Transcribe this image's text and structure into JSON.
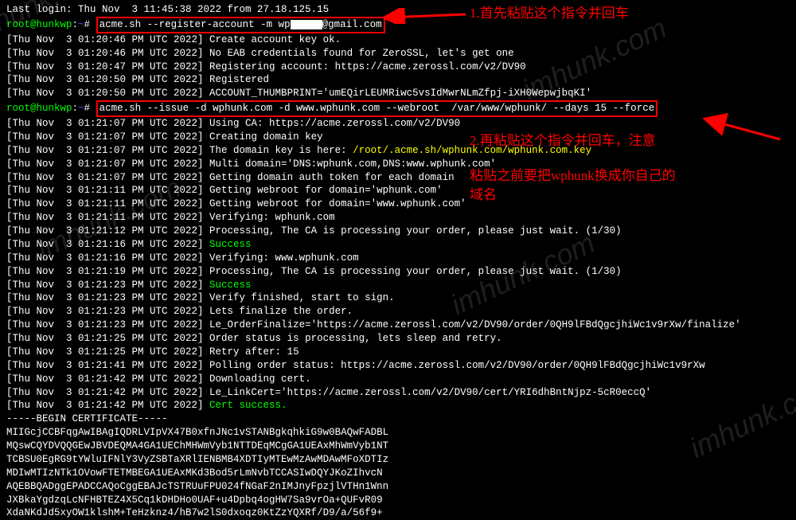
{
  "login_line": "Last login: Thu Nov  3 11:45:38 2022 from 27.18.125.15",
  "prompt": {
    "user_host": "root@hunkwp",
    "sep": ":",
    "path": "~",
    "symbol": "#"
  },
  "cmd1": {
    "before": "acme.sh --register-account -m wp",
    "after": "@gmail.com"
  },
  "cmd2": "acme.sh --issue -d wphunk.com -d www.wphunk.com --webroot  /var/www/wphunk/ --days 15 --force",
  "log_prefix": {
    "0": "[Thu Nov  3 01:20:46 PM UTC 2022] ",
    "1": "[Thu Nov  3 01:20:46 PM UTC 2022] ",
    "2": "[Thu Nov  3 01:20:47 PM UTC 2022] ",
    "3": "[Thu Nov  3 01:20:50 PM UTC 2022] ",
    "4": "[Thu Nov  3 01:20:50 PM UTC 2022] ",
    "5": "[Thu Nov  3 01:21:07 PM UTC 2022] ",
    "6": "[Thu Nov  3 01:21:07 PM UTC 2022] ",
    "7": "[Thu Nov  3 01:21:07 PM UTC 2022] ",
    "8": "[Thu Nov  3 01:21:07 PM UTC 2022] ",
    "9": "[Thu Nov  3 01:21:07 PM UTC 2022] ",
    "10": "[Thu Nov  3 01:21:11 PM UTC 2022] ",
    "11": "[Thu Nov  3 01:21:11 PM UTC 2022] ",
    "12": "[Thu Nov  3 01:21:11 PM UTC 2022] ",
    "13": "[Thu Nov  3 01:21:12 PM UTC 2022] ",
    "14": "[Thu Nov  3 01:21:16 PM UTC 2022] ",
    "15": "[Thu Nov  3 01:21:16 PM UTC 2022] ",
    "16": "[Thu Nov  3 01:21:19 PM UTC 2022] ",
    "17": "[Thu Nov  3 01:21:23 PM UTC 2022] ",
    "18": "[Thu Nov  3 01:21:23 PM UTC 2022] ",
    "19": "[Thu Nov  3 01:21:23 PM UTC 2022] ",
    "20": "[Thu Nov  3 01:21:23 PM UTC 2022] ",
    "21": "[Thu Nov  3 01:21:25 PM UTC 2022] ",
    "22": "[Thu Nov  3 01:21:25 PM UTC 2022] ",
    "23": "[Thu Nov  3 01:21:41 PM UTC 2022] ",
    "24": "[Thu Nov  3 01:21:42 PM UTC 2022] ",
    "25": "[Thu Nov  3 01:21:42 PM UTC 2022] ",
    "26": "[Thu Nov  3 01:21:42 PM UTC 2022] "
  },
  "log_msg": {
    "0": "Create account key ok.",
    "1": "No EAB credentials found for ZeroSSL, let's get one",
    "2": "Registering account: https://acme.zerossl.com/v2/DV90",
    "3": "Registered",
    "4": "ACCOUNT_THUMBPRINT='umEQirLEUMRiwc5vsIdMwrNLmZfpj-iXH0WepwjbqKI'",
    "5": "Using CA: https://acme.zerossl.com/v2/DV90",
    "6": "Creating domain key",
    "7a": "The domain key is here: ",
    "7b": "/root/.acme.sh/wphunk.com/wphunk.com.key",
    "8": "Multi domain='DNS:wphunk.com,DNS:www.wphunk.com'",
    "9": "Getting domain auth token for each domain",
    "10": "Getting webroot for domain='wphunk.com'",
    "11": "Getting webroot for domain='www.wphunk.com'",
    "12": "Verifying: wphunk.com",
    "13": "Processing, The CA is processing your order, please just wait. (1/30)",
    "14": "Success",
    "15": "Verifying: www.wphunk.com",
    "16": "Processing, The CA is processing your order, please just wait. (1/30)",
    "17": "Success",
    "18": "Verify finished, start to sign.",
    "19": "Lets finalize the order.",
    "20": "Le_OrderFinalize='https://acme.zerossl.com/v2/DV90/order/0QH9lFBdQgcjhiWc1v9rXw/finalize'",
    "21": "Order status is processing, lets sleep and retry.",
    "22": "Retry after: 15",
    "23": "Polling order status: https://acme.zerossl.com/v2/DV90/order/0QH9lFBdQgcjhiWc1v9rXw",
    "24": "Downloading cert.",
    "25": "Le_LinkCert='https://acme.zerossl.com/v2/DV90/cert/YRI6dhBntNjpz-5cR0eccQ'",
    "26": "Cert success."
  },
  "cert": {
    "begin": "-----BEGIN CERTIFICATE-----",
    "l1": "MIIGcjCCBFqgAwIBAgIQDRLVIpVX47B0xfnJNc1vSTANBgkqhkiG9w0BAQwFADBL",
    "l2": "MQswCQYDVQQGEwJBVDEQMA4GA1UEChMHWmVyb1NTTDEqMCgGA1UEAxMhWmVyb1NT",
    "l3": "TCBSU0EgRG9tYWluIFNlY3VyZSBTaXRlIENBMB4XDTIyMTEwMzAwMDAwMFoXDTIz",
    "l4": "MDIwMTIzNTk1OVowFTETMBEGA1UEAxMKd3Bod5rLmNvbTCCASIwDQYJKoZIhvcN",
    "l5": "AQEBBQADggEPADCCAQoCggEBAJcTSTRUuFPU024fNGaF2nIMJnyFpzjlVTHn1Wnn",
    "l6": "JXBkaYgdzqLcNFHBTEZ4X5Cq1kDHDHo0UAF+u4Dpbq4ogHW7Sa9vrOa+QUFvR09",
    "l7": "XdaNKdJd5xyOW1klshM+TeHzknz4/hB7w2lS0dxoqz0KtZzYQXRf/D9/a/56f9+"
  },
  "annotations": {
    "a1": "1.首先粘贴这个指令并回车",
    "a2": "2.再粘贴这个指令并回车，注意",
    "a3": "粘贴之前要把wphunk换成你自己的",
    "a4": "域名"
  },
  "watermark": "imhunk.com"
}
